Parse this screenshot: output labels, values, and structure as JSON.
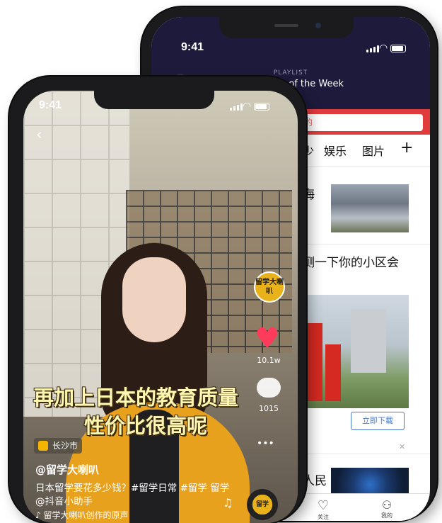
{
  "back_phone": {
    "time": "9:41",
    "playlist_label": "PLAYLIST",
    "playlist_title": "Best Vibes of the Week",
    "search_text": "的",
    "tabs": [
      "少",
      "娱乐",
      "图片"
    ],
    "add_tab": "+",
    "news": [
      {
        "title": "海"
      },
      {
        "title": "测一下你的小区会"
      },
      {
        "title": "人民"
      }
    ],
    "download_button": "立即下载",
    "bottom_nav": [
      {
        "label": "关注",
        "icon": "heart-icon"
      },
      {
        "label": "我的",
        "icon": "person-icon"
      }
    ]
  },
  "front_phone": {
    "time": "9:41",
    "badge": "留学大喇叭",
    "like_count": "10.1w",
    "comment_count": "1015",
    "caption_line1": "再加上日本的教育质量",
    "caption_line2": "性价比很高呢",
    "location": "长沙市",
    "username": "@留学大喇叭",
    "description": "日本留学要花多少钱？#留学日常 #留学 留学 @抖音小助手",
    "music": "♪ 留学大喇叭创作的原声",
    "more": "•••",
    "disc_label": "留学"
  },
  "colors": {
    "back_header": "#1d1a3b",
    "red_bar": "#e23b3b",
    "heart": "#ff3b5c",
    "caption": "#fff7b0"
  }
}
